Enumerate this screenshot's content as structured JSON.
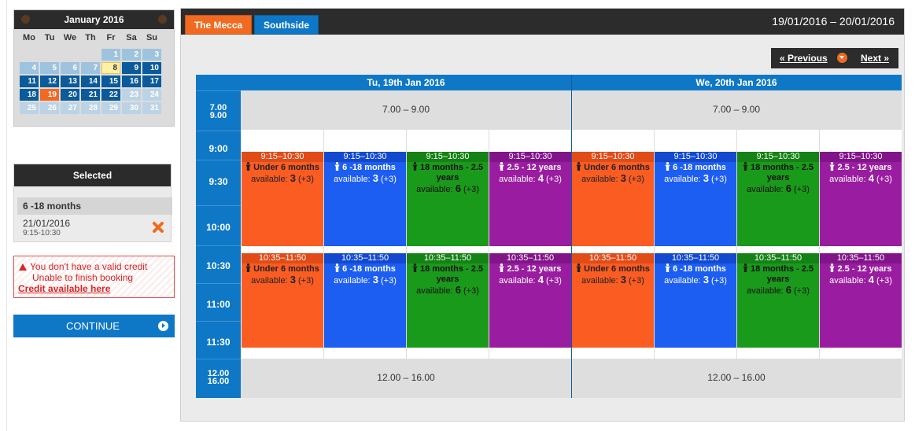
{
  "calendar": {
    "month_label": "January 2016",
    "weekdays": [
      "Mo",
      "Tu",
      "We",
      "Th",
      "Fr",
      "Sa",
      "Su"
    ],
    "rows": [
      [
        "",
        "",
        "",
        "",
        "1",
        "2",
        "3"
      ],
      [
        "4",
        "5",
        "6",
        "7",
        "8",
        "9",
        "10"
      ],
      [
        "11",
        "12",
        "13",
        "14",
        "15",
        "16",
        "17"
      ],
      [
        "18",
        "19",
        "20",
        "21",
        "22",
        "23",
        "24"
      ],
      [
        "25",
        "26",
        "27",
        "28",
        "29",
        "30",
        "31"
      ]
    ],
    "states": [
      [
        "empty",
        "empty",
        "empty",
        "empty",
        "past",
        "past",
        "past"
      ],
      [
        "past",
        "past",
        "past",
        "past",
        "today",
        "av",
        "av"
      ],
      [
        "av",
        "av",
        "av",
        "av",
        "av",
        "av",
        "av"
      ],
      [
        "av",
        "sel",
        "av",
        "av",
        "av",
        "dim",
        "dim"
      ],
      [
        "dim",
        "dim",
        "dim",
        "dim",
        "dim",
        "dim",
        "dim"
      ]
    ]
  },
  "selected": {
    "title": "Selected",
    "group": "6 -18 months",
    "date": "21/01/2016",
    "time": "9:15-10:30"
  },
  "error": {
    "line1": "You don't have a valid credit",
    "line2": "Unable to finish booking",
    "link": "Credit available here"
  },
  "continue_label": "CONTINUE",
  "tabs": [
    "The Mecca",
    "Southside"
  ],
  "date_range": "19/01/2016 – 20/01/2016",
  "pager": {
    "prev": "« Previous",
    "next": "Next »"
  },
  "days": [
    "Tu, 19th Jan 2016",
    "We, 20th Jan 2016"
  ],
  "times": {
    "early_start": "7.00",
    "early_end": "9.00",
    "hours": [
      "9:00",
      "9:30",
      "10:00",
      "10:30",
      "11:00",
      "11:30"
    ],
    "late_start": "12.00",
    "late_end": "16.00"
  },
  "blocked": {
    "early": "7.00 – 9.00",
    "late": "12.00 – 16.00"
  },
  "groups": [
    {
      "name": "Under 6 months",
      "available": "3",
      "extra": "(+3)",
      "color": "#fa5c22"
    },
    {
      "name": "6 -18 months",
      "available": "3",
      "extra": "(+3)",
      "color": "#1c5df2"
    },
    {
      "name": "18 months - 2.5 years",
      "available": "6",
      "extra": "(+3)",
      "color": "#1a9a1a"
    },
    {
      "name": "2.5 - 12 years",
      "available": "4",
      "extra": "(+3)",
      "color": "#9a1ca0"
    }
  ],
  "sessions": [
    "9:15–10:30",
    "10:35–11:50"
  ],
  "available_label": "available: "
}
